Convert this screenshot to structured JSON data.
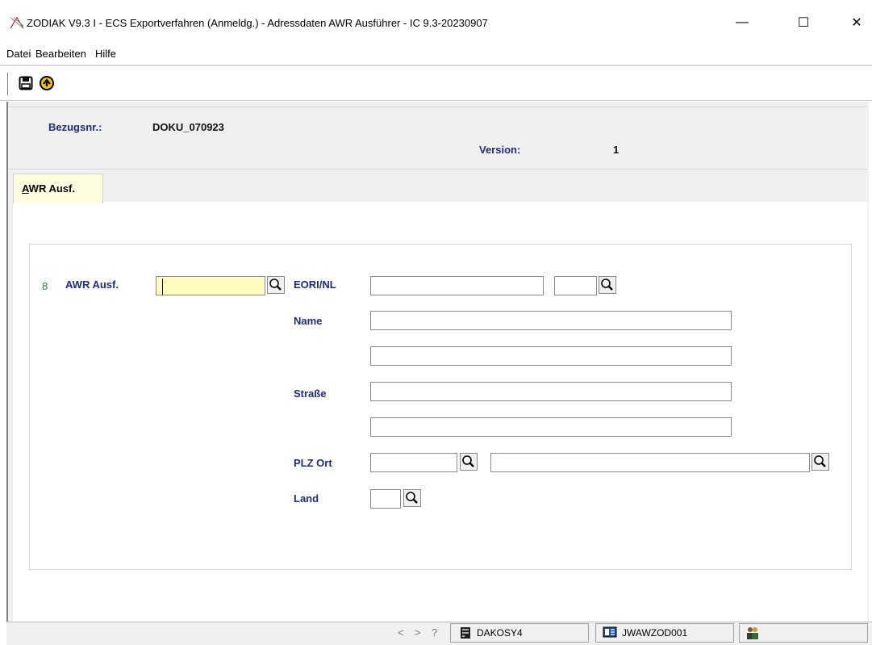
{
  "window": {
    "title": "ZODIAK V9.3 I - ECS Exportverfahren (Anmeldg.) - Adressdaten AWR Ausführer - IC 9.3-20230907",
    "minimize": "—",
    "maximize": "☐",
    "close": "✕"
  },
  "menu": {
    "items": [
      "Datei",
      "Bearbeiten",
      "Hilfe"
    ]
  },
  "toolbar": {
    "buttons": [
      {
        "icon": "save-icon"
      },
      {
        "icon": "exit-icon"
      }
    ]
  },
  "header": {
    "bezugsnr_label": "Bezugsnr.:",
    "bezugsnr_value": "DOKU_070923",
    "version_label": "Version:",
    "version_value": "1"
  },
  "tabs": [
    {
      "label_prefix": "A",
      "label_rest": "WR Ausf."
    }
  ],
  "form": {
    "row_number": "8",
    "awr_label": "AWR Ausf.",
    "awr_value": "",
    "eori_label": "EORI/NL",
    "eori_value": "",
    "nl_value": "",
    "name_label": "Name",
    "name1_value": "",
    "name2_value": "",
    "strasse_label": "Straße",
    "strasse1_value": "",
    "strasse2_value": "",
    "plz_label": "PLZ Ort",
    "plz_value": "",
    "ort_value": "",
    "land_label": "Land",
    "land_value": ""
  },
  "status": {
    "nav_prev": "<",
    "nav_next": ">",
    "nav_help": "?",
    "server": "DAKOSY4",
    "station": "JWAWZOD001"
  },
  "colors": {
    "label_blue": "#1f2a7a",
    "tab_bg": "#fffde0",
    "active_input": "#fffdbf",
    "row_number_green": "#2e7d32"
  }
}
